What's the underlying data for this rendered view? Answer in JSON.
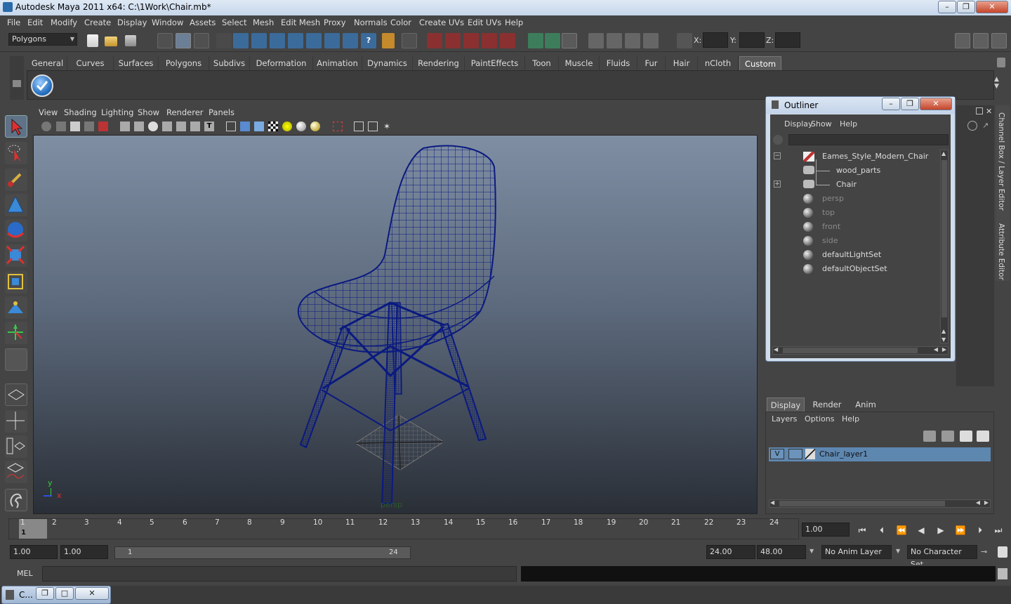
{
  "window": {
    "title": "Autodesk Maya 2011 x64: C:\\1Work\\Chair.mb*",
    "min": "–",
    "max": "❐",
    "close": "✕"
  },
  "menubar": [
    "File",
    "Edit",
    "Modify",
    "Create",
    "Display",
    "Window",
    "Assets",
    "Select",
    "Mesh",
    "Edit Mesh",
    "Proxy",
    "Normals",
    "Color",
    "Create UVs",
    "Edit UVs",
    "Help"
  ],
  "statusline": {
    "mode": "Polygons",
    "x_label": "X:",
    "y_label": "Y:",
    "z_label": "Z:"
  },
  "shelf": {
    "tabs": [
      "General",
      "Curves",
      "Surfaces",
      "Polygons",
      "Subdivs",
      "Deformation",
      "Animation",
      "Dynamics",
      "Rendering",
      "PaintEffects",
      "Toon",
      "Muscle",
      "Fluids",
      "Fur",
      "Hair",
      "nCloth",
      "Custom"
    ],
    "active": "Custom"
  },
  "viewport": {
    "menu": [
      "View",
      "Shading",
      "Lighting",
      "Show",
      "Renderer",
      "Panels"
    ],
    "camera_label": "persp",
    "axis_y": "y",
    "axis_x": "x"
  },
  "outliner": {
    "title": "Outliner",
    "menu": [
      "Display",
      "Show",
      "Help"
    ],
    "min": "–",
    "max": "❐",
    "close": "✕",
    "items": [
      {
        "label": "Eames_Style_Modern_Chair",
        "dim": false
      },
      {
        "label": "wood_parts",
        "dim": false
      },
      {
        "label": "Chair",
        "dim": false
      },
      {
        "label": "persp",
        "dim": true
      },
      {
        "label": "top",
        "dim": true
      },
      {
        "label": "front",
        "dim": true
      },
      {
        "label": "side",
        "dim": true
      },
      {
        "label": "defaultLightSet",
        "dim": false
      },
      {
        "label": "defaultObjectSet",
        "dim": false
      }
    ]
  },
  "side_tabs": {
    "channel_box": "Channel Box / Layer Editor",
    "attribute_editor": "Attribute Editor"
  },
  "layer_editor": {
    "tabs": [
      "Display",
      "Render",
      "Anim"
    ],
    "active": "Display",
    "menu": [
      "Layers",
      "Options",
      "Help"
    ],
    "layer_visible": "V",
    "layer_name": "Chair_layer1"
  },
  "timeline": {
    "ticks": [
      "1",
      "2",
      "3",
      "4",
      "5",
      "6",
      "7",
      "8",
      "9",
      "10",
      "11",
      "12",
      "13",
      "14",
      "15",
      "16",
      "17",
      "18",
      "19",
      "20",
      "21",
      "22",
      "23",
      "24"
    ],
    "current_frame_marker": "1",
    "current_time": "1.00"
  },
  "range": {
    "start_time": "1.00",
    "playback_start": "1.00",
    "range_start_label": "1",
    "range_end_label": "24",
    "playback_end": "24.00",
    "end_time": "48.00",
    "anim_layer": "No Anim Layer",
    "character_set": "No Character Set"
  },
  "command_line": {
    "label": "MEL"
  },
  "taskbar": {
    "item": "C..."
  },
  "colors": {
    "wireframe": "#0a1a80",
    "selection_highlight": "#5e87b0",
    "ui_bg": "#444444"
  }
}
